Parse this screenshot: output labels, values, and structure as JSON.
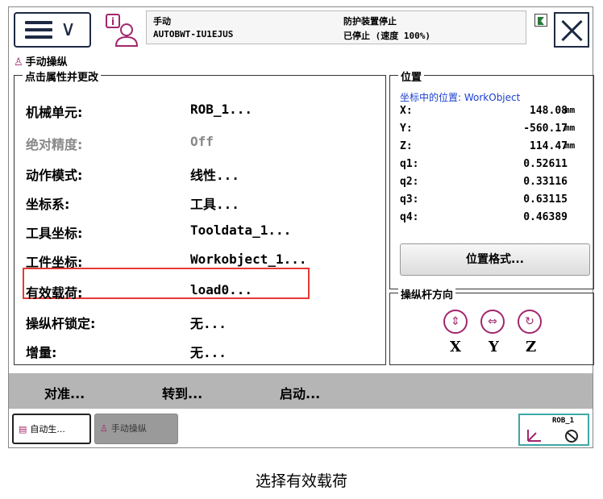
{
  "header": {
    "mode": "手动",
    "system_name": "AUTOBWT-IU1EJUS",
    "guard_status": "防护装置停止",
    "run_status": "已停止 (速度 100%)"
  },
  "window_title": "手动操纵",
  "properties": {
    "group_title": "点击属性并更改",
    "rows": [
      {
        "label": "机械单元:",
        "value": "ROB_1..."
      },
      {
        "label": "绝对精度:",
        "value": "Off"
      },
      {
        "label": "动作模式:",
        "value": "线性..."
      },
      {
        "label": "坐标系:",
        "value": "工具..."
      },
      {
        "label": "工具坐标:",
        "value": "Tooldata_1..."
      },
      {
        "label": "工件坐标:",
        "value": "Workobject_1..."
      },
      {
        "label": "有效载荷:",
        "value": "load0..."
      },
      {
        "label": "操纵杆锁定:",
        "value": "无..."
      },
      {
        "label": "增量:",
        "value": "无..."
      }
    ]
  },
  "position": {
    "group_title": "位置",
    "frame_label": "坐标中的位置: WorkObject",
    "rows": [
      {
        "axis": "X:",
        "value": "148.08",
        "unit": "mm"
      },
      {
        "axis": "Y:",
        "value": "-560.17",
        "unit": "mm"
      },
      {
        "axis": "Z:",
        "value": "114.47",
        "unit": "mm"
      },
      {
        "axis": "q1:",
        "value": "0.52611",
        "unit": ""
      },
      {
        "axis": "q2:",
        "value": "0.33116",
        "unit": ""
      },
      {
        "axis": "q3:",
        "value": "0.63115",
        "unit": ""
      },
      {
        "axis": "q4:",
        "value": "0.46389",
        "unit": ""
      }
    ],
    "format_button": "位置格式..."
  },
  "joystick": {
    "group_title": "操纵杆方向",
    "axes": [
      "X",
      "Y",
      "Z"
    ]
  },
  "actions": {
    "align": "对准...",
    "goto": "转到...",
    "start": "启动..."
  },
  "taskbar": {
    "task1": "自动生...",
    "task2": "手动操纵",
    "robot": "ROB_1"
  },
  "caption": "选择有效载荷",
  "colors": {
    "accent": "#a2266d",
    "highlight": "#e53935",
    "action_bar": "#b5b5b5",
    "link": "#1a3fd0"
  }
}
